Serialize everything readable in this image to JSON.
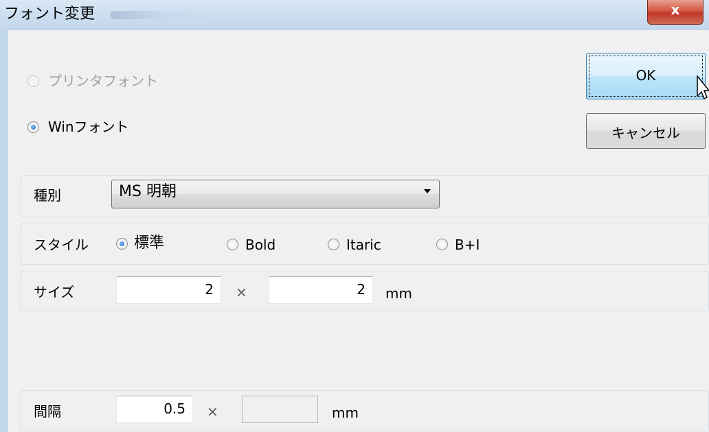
{
  "window": {
    "title": "フォント変更",
    "close_label": "x"
  },
  "font_source": {
    "printer_font_label": "プリンタフォント",
    "win_font_label": "Winフォント",
    "selected": "Winフォント"
  },
  "buttons": {
    "ok_label": "OK",
    "cancel_label": "キャンセル"
  },
  "type_row": {
    "label": "種別",
    "selected_font": "MS 明朝"
  },
  "style_row": {
    "label": "スタイル",
    "options": [
      "標準",
      "Bold",
      "Itaric",
      "B+I"
    ],
    "selected": "標準"
  },
  "size_row": {
    "label": "サイズ",
    "width": "2",
    "separator": "×",
    "height": "2",
    "unit": "mm"
  },
  "spacing_row": {
    "label": "間隔",
    "x": "0.5",
    "separator": "×",
    "y": "",
    "unit": "mm"
  },
  "colors": {
    "title_bar": "#c2d6ec",
    "close_button": "#c0382b",
    "default_button": "#a7d9f5",
    "radio_checked": "#1b5fb0"
  }
}
